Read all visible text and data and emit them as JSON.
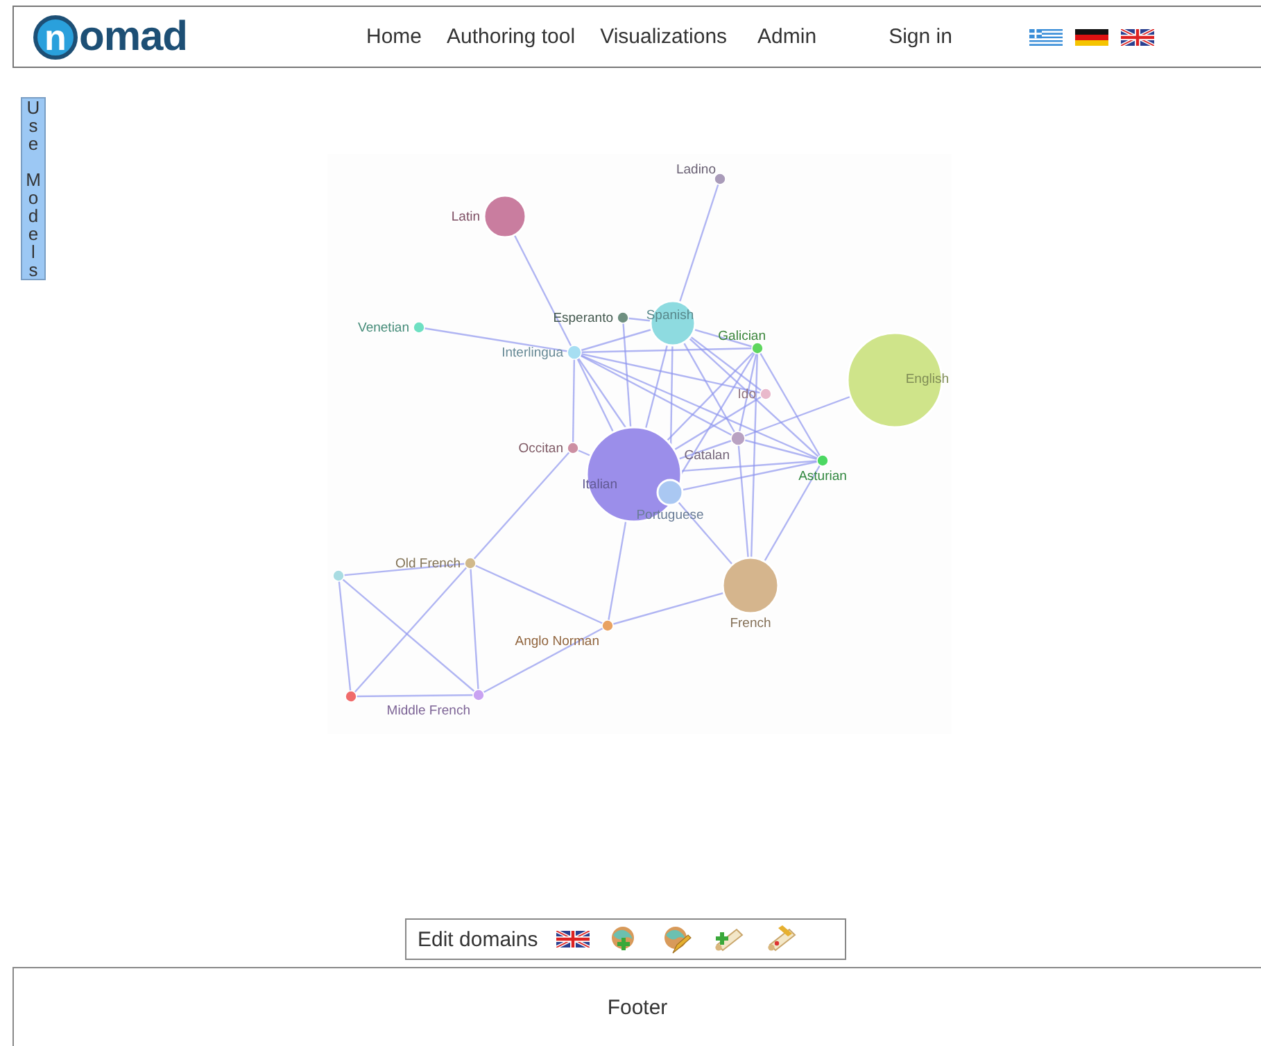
{
  "header": {
    "logo": {
      "bubble": "n",
      "rest": "omad"
    },
    "nav": [
      "Home",
      "Authoring tool",
      "Visualizations",
      "Admin"
    ],
    "sign_in": "Sign in",
    "languages": [
      {
        "kind": "greek"
      },
      {
        "kind": "german"
      },
      {
        "kind": "british"
      }
    ]
  },
  "side_tab": {
    "label": "Use Models"
  },
  "graph": {
    "nodes": [
      {
        "label": "Ladino",
        "color": "#a99bb9"
      },
      {
        "label": "Latin",
        "color": "#c97d9f"
      },
      {
        "label": "Esperanto",
        "color": "#6e8f80"
      },
      {
        "label": "Spanish",
        "color": "#8edbe0"
      },
      {
        "label": "Venetian",
        "color": "#6ee0c2"
      },
      {
        "label": "Interlingua",
        "color": "#a6def2"
      },
      {
        "label": "Galician",
        "color": "#5ed65e"
      },
      {
        "label": "English",
        "color": "#cfe48a"
      },
      {
        "label": "Ido",
        "color": "#e9b9cc"
      },
      {
        "label": "Catalan",
        "color": "#b9a2c2"
      },
      {
        "label": "Asturian",
        "color": "#4cd862"
      },
      {
        "label": "Occitan",
        "color": "#cc8fa2"
      },
      {
        "label": "Italian",
        "color": "#9b8eea"
      },
      {
        "label": "Portuguese",
        "color": "#aac8f2"
      },
      {
        "label": "Old French",
        "color": "#d1b98b"
      },
      {
        "color": "#a9dce2"
      },
      {
        "label": "French",
        "color": "#d5b58d"
      },
      {
        "label": "Anglo Norman",
        "color": "#e9a262"
      },
      {
        "color": "#f06b6b"
      },
      {
        "label": "Middle French",
        "color": "#c9a2f2"
      }
    ]
  },
  "toolbar": {
    "label": "Edit domains",
    "language": {
      "kind": "british"
    },
    "tools": [
      {
        "kind": "globe-add"
      },
      {
        "kind": "globe-edit"
      },
      {
        "kind": "scroll-add"
      },
      {
        "kind": "scroll-edit"
      }
    ]
  },
  "footer": {
    "text": "Footer"
  }
}
